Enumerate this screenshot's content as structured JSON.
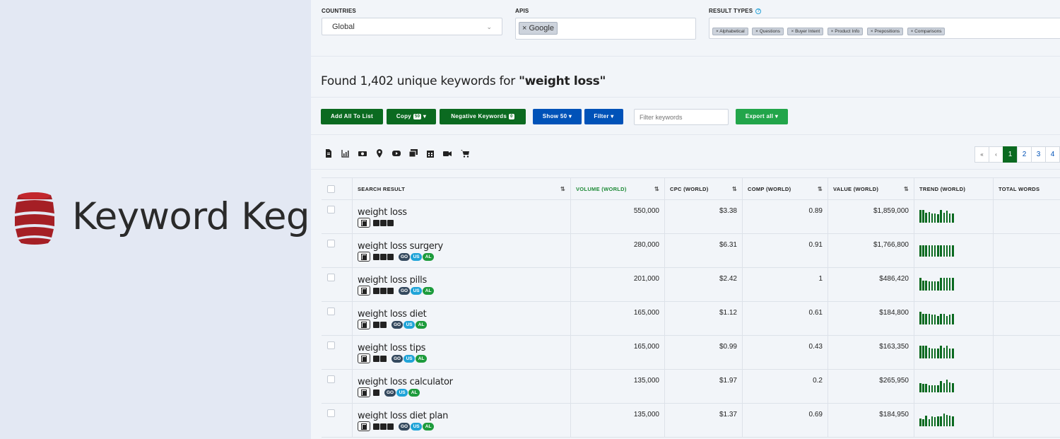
{
  "brand": {
    "name": "Keyword Keg"
  },
  "filters": {
    "countries_label": "COUNTRIES",
    "countries_value": "Global",
    "apis_label": "APIS",
    "apis_tags": [
      "Google"
    ],
    "result_types_label": "RESULT TYPES",
    "result_types_tags": [
      "Alphabetical",
      "Questions",
      "Buyer Intent",
      "Product Info",
      "Prepositions",
      "Comparisons"
    ]
  },
  "summary": {
    "prefix": "Found 1,402 unique keywords for ",
    "query": "\"weight loss\""
  },
  "toolbar": {
    "add_all": "Add All To List",
    "copy": "Copy",
    "copy_badge": "50",
    "negative": "Negative Keywords",
    "negative_badge": "0",
    "show": "Show 50",
    "filter": "Filter",
    "filter_placeholder": "Filter keywords",
    "export": "Export all"
  },
  "icon_bar": [
    "file-icon",
    "chart-icon",
    "money-icon",
    "location-icon",
    "youtube-icon",
    "images-icon",
    "calendar-icon",
    "video-icon",
    "cart-icon"
  ],
  "pagination": {
    "first": "«",
    "prev": "‹",
    "pages": [
      "1",
      "2",
      "3",
      "4"
    ],
    "active": "1"
  },
  "table": {
    "headers": {
      "search_result": "SEARCH RESULT",
      "volume": "VOLUME (WORLD)",
      "cpc": "CPC (WORLD)",
      "comp": "COMP (WORLD)",
      "value": "VALUE (WORLD)",
      "trend": "TREND (WORLD)",
      "total_words": "TOTAL WORDS"
    },
    "rows": [
      {
        "keyword": "weight loss",
        "volume": "550,000",
        "cpc": "$3.38",
        "comp": "0.89",
        "value": "$1,859,000",
        "icons": 3,
        "pills": [],
        "trend": [
          0.95,
          0.95,
          0.75,
          0.8,
          0.7,
          0.7,
          0.65,
          0.95,
          0.75,
          0.9,
          0.7,
          0.7
        ]
      },
      {
        "keyword": "weight loss surgery",
        "volume": "280,000",
        "cpc": "$6.31",
        "comp": "0.91",
        "value": "$1,766,800",
        "icons": 3,
        "pills": [
          "GO",
          "US",
          "AL"
        ],
        "trend": [
          0.85,
          0.85,
          0.85,
          0.85,
          0.85,
          0.85,
          0.85,
          0.85,
          0.85,
          0.85,
          0.85,
          0.85
        ]
      },
      {
        "keyword": "weight loss pills",
        "volume": "201,000",
        "cpc": "$2.42",
        "comp": "1",
        "value": "$486,420",
        "icons": 3,
        "pills": [
          "GO",
          "US",
          "AL"
        ],
        "trend": [
          0.95,
          0.75,
          0.75,
          0.7,
          0.7,
          0.7,
          0.7,
          0.95,
          0.95,
          0.95,
          0.95,
          0.95
        ]
      },
      {
        "keyword": "weight loss diet",
        "volume": "165,000",
        "cpc": "$1.12",
        "comp": "0.61",
        "value": "$184,800",
        "icons": 2,
        "pills": [
          "GO",
          "US",
          "AL"
        ],
        "trend": [
          0.95,
          0.8,
          0.8,
          0.8,
          0.75,
          0.75,
          0.65,
          0.8,
          0.8,
          0.65,
          0.75,
          0.8
        ]
      },
      {
        "keyword": "weight loss tips",
        "volume": "165,000",
        "cpc": "$0.99",
        "comp": "0.43",
        "value": "$163,350",
        "icons": 2,
        "pills": [
          "GO",
          "US",
          "AL"
        ],
        "trend": [
          0.95,
          0.95,
          0.95,
          0.8,
          0.75,
          0.75,
          0.75,
          0.95,
          0.8,
          0.95,
          0.75,
          0.75
        ]
      },
      {
        "keyword": "weight loss calculator",
        "volume": "135,000",
        "cpc": "$1.97",
        "comp": "0.2",
        "value": "$265,950",
        "icons": 1,
        "pills": [
          "GO",
          "US",
          "AL"
        ],
        "trend": [
          0.7,
          0.65,
          0.65,
          0.55,
          0.55,
          0.55,
          0.5,
          0.85,
          0.7,
          0.95,
          0.75,
          0.7
        ]
      },
      {
        "keyword": "weight loss diet plan",
        "volume": "135,000",
        "cpc": "$1.37",
        "comp": "0.69",
        "value": "$184,950",
        "icons": 3,
        "pills": [
          "GO",
          "US",
          "AL"
        ],
        "trend": [
          0.6,
          0.55,
          0.8,
          0.55,
          0.75,
          0.7,
          0.75,
          0.75,
          0.95,
          0.85,
          0.8,
          0.75
        ]
      }
    ]
  }
}
